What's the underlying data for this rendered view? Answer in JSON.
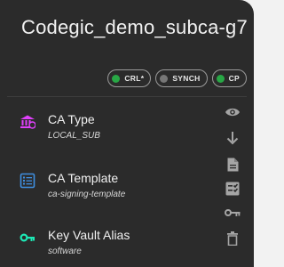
{
  "card": {
    "title": "Codegic_demo_subca-g7"
  },
  "badges": [
    {
      "label": "CRL*",
      "status_color": "#28a745"
    },
    {
      "label": "SYNCH",
      "status_color": "#777777"
    },
    {
      "label": "CP",
      "status_color": "#28a745"
    }
  ],
  "details": [
    {
      "label": "CA Type",
      "value": "LOCAL_SUB",
      "icon": "bank-icon",
      "icon_color": "#e040fb"
    },
    {
      "label": "CA Template",
      "value": "ca-signing-template",
      "icon": "list-icon",
      "icon_color": "#3f8fe0"
    },
    {
      "label": "Key Vault Alias",
      "value": "software",
      "icon": "key-icon",
      "icon_color": "#1de9b6"
    }
  ],
  "actions": [
    {
      "icon": "eye-icon"
    },
    {
      "icon": "arrow-down-icon"
    },
    {
      "icon": "document-icon"
    },
    {
      "icon": "checklist-icon"
    },
    {
      "icon": "key-icon"
    },
    {
      "icon": "trash-icon"
    }
  ],
  "colors": {
    "card_background": "#2b2b2b",
    "text": "#f1f1f1",
    "action_icon": "#a5a5a5"
  }
}
